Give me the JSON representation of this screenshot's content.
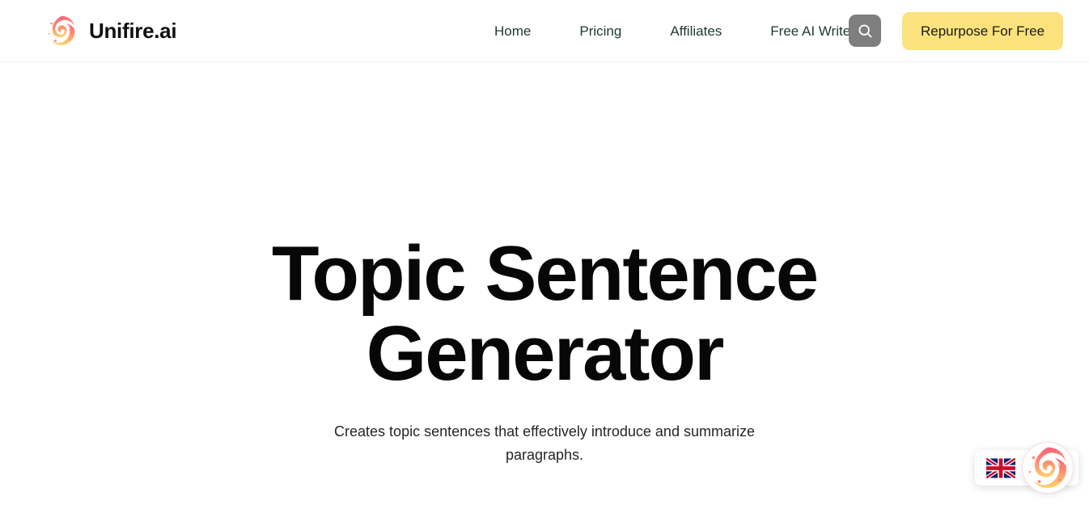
{
  "header": {
    "brand": {
      "logo_icon": "unifire-flame-logo-icon",
      "name": "Unifire.ai"
    },
    "nav": [
      {
        "label": "Home",
        "name": "nav-link-home"
      },
      {
        "label": "Pricing",
        "name": "nav-link-pricing"
      },
      {
        "label": "Affiliates",
        "name": "nav-link-affiliates"
      },
      {
        "label": "Free AI Writer",
        "name": "nav-link-free-ai-writer"
      }
    ],
    "search": {
      "icon": "search-icon",
      "aria_label": "Search"
    },
    "cta": {
      "label": "Repurpose For Free"
    }
  },
  "hero": {
    "title_line1": "Topic Sentence",
    "title_line2": "Generator",
    "subtitle": "Creates topic sentences that effectively introduce and summarize paragraphs."
  },
  "widget": {
    "language": {
      "icon": "uk-flag-icon",
      "label": "English (UK)"
    },
    "chat_launcher": {
      "icon": "unifire-flame-logo-icon",
      "label": "Open Unifire assistant"
    }
  },
  "colors": {
    "page_background": "#ffffff",
    "header_border": "#eceef0",
    "nav_text": "#1e3a32",
    "cta_background": "#fbe27c",
    "cta_text": "#1a1a1a",
    "search_background": "#7e7e7e",
    "heading_text": "#070707",
    "subtitle_text": "#24262b",
    "logo_gradient_start": "#f8617f",
    "logo_gradient_end": "#ffd36b"
  }
}
